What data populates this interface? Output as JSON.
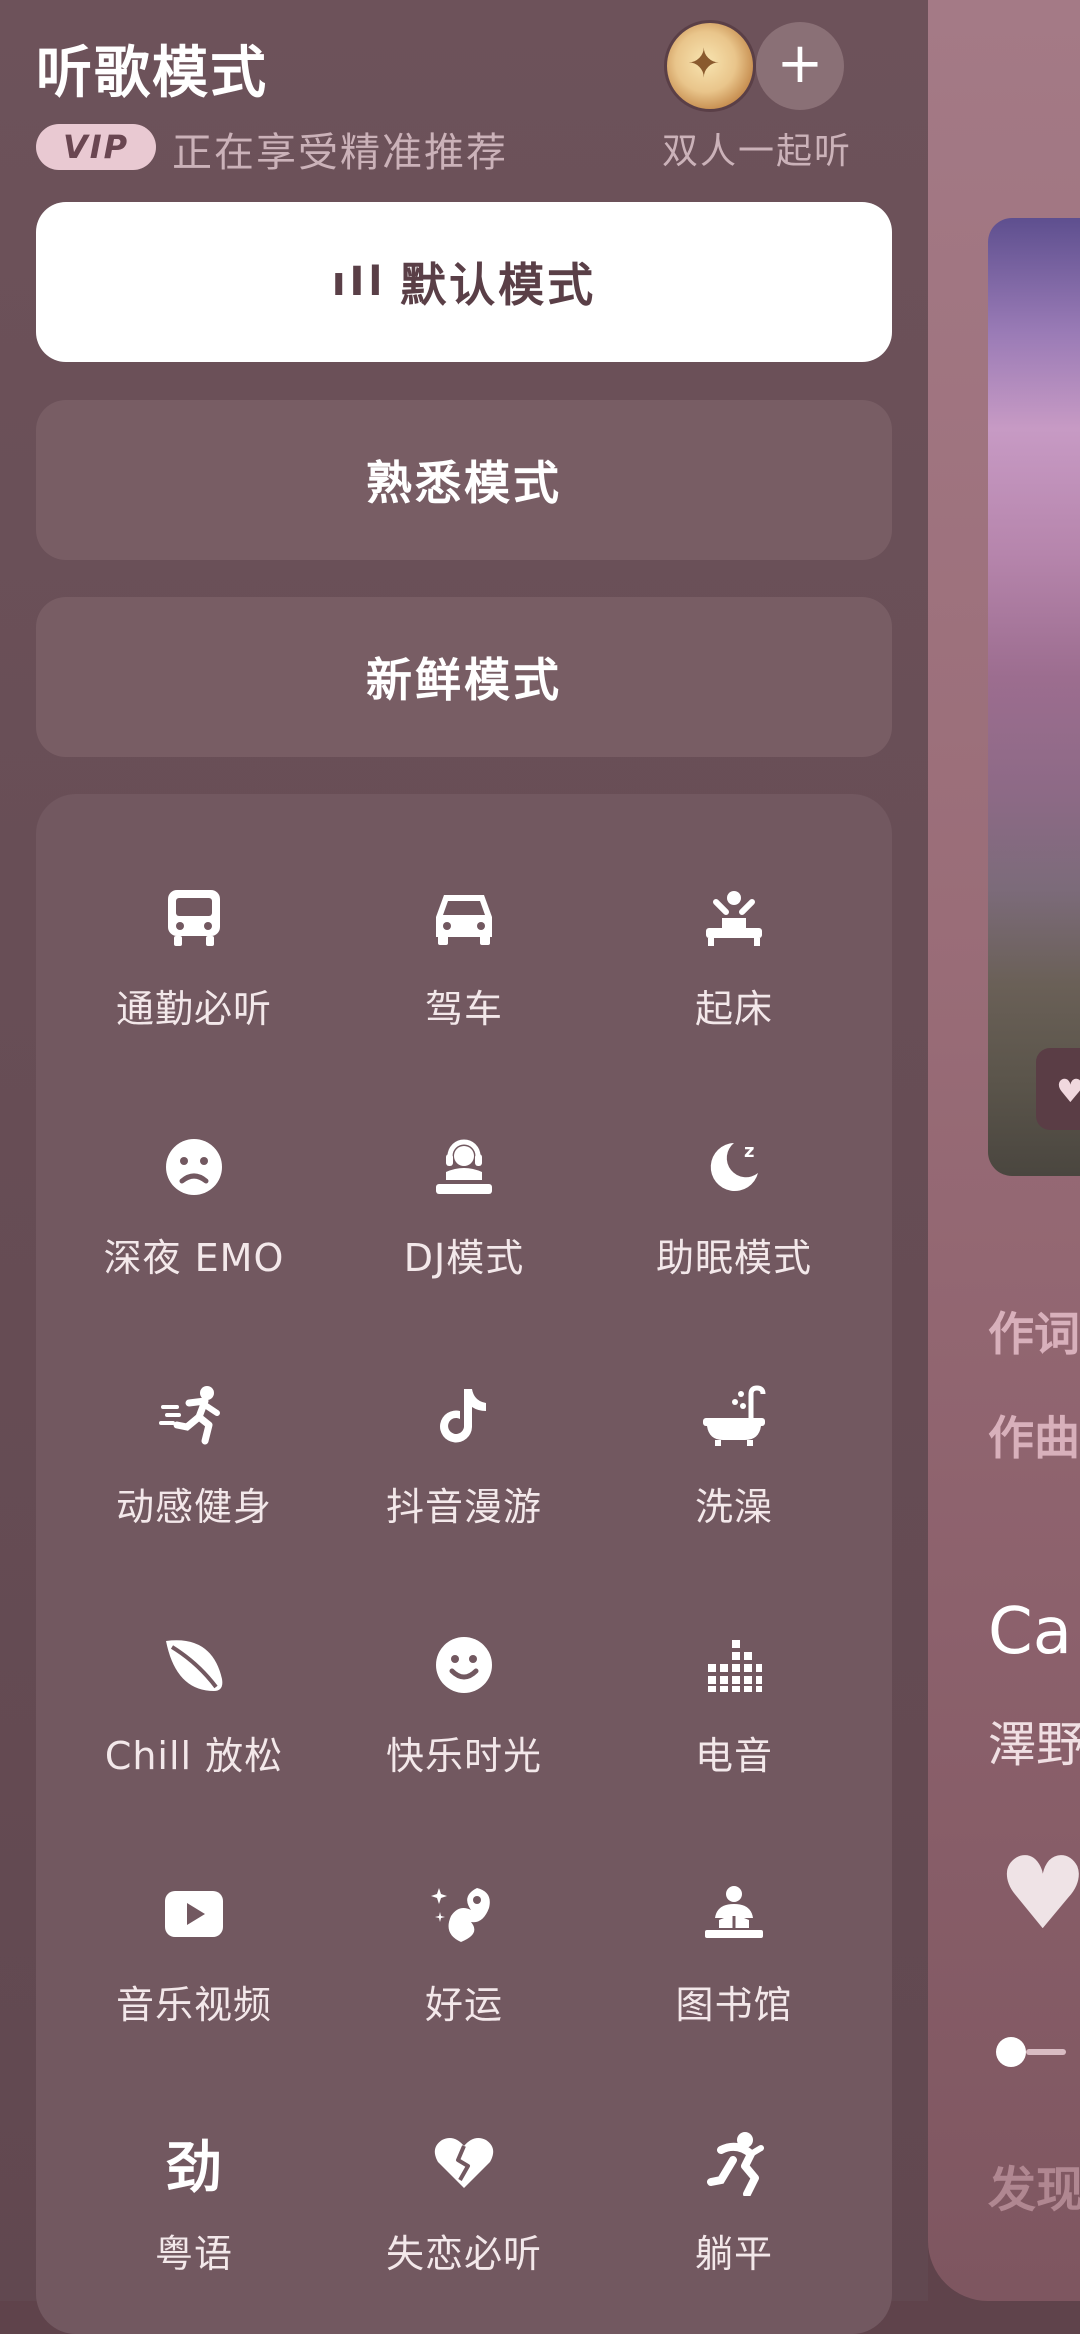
{
  "header": {
    "title": "听歌模式",
    "vip_badge": "VIP",
    "vip_text": "正在享受精准推荐",
    "plus_label": "+",
    "duet_label": "双人一起听"
  },
  "modes": {
    "default_bars": "ıIl",
    "default": "默认模式",
    "familiar": "熟悉模式",
    "fresh": "新鲜模式"
  },
  "scenes": [
    {
      "label": "通勤必听",
      "icon": "bus-icon"
    },
    {
      "label": "驾车",
      "icon": "car-icon"
    },
    {
      "label": "起床",
      "icon": "wake-up-icon"
    },
    {
      "label": "深夜 EMO",
      "icon": "sad-face-icon"
    },
    {
      "label": "DJ模式",
      "icon": "dj-icon"
    },
    {
      "label": "助眠模式",
      "icon": "moon-sleep-icon"
    },
    {
      "label": "动感健身",
      "icon": "running-icon"
    },
    {
      "label": "抖音漫游",
      "icon": "tiktok-icon"
    },
    {
      "label": "洗澡",
      "icon": "bathtub-icon"
    },
    {
      "label": "Chill 放松",
      "icon": "leaf-icon"
    },
    {
      "label": "快乐时光",
      "icon": "smile-icon"
    },
    {
      "label": "电音",
      "icon": "equalizer-icon"
    },
    {
      "label": "音乐视频",
      "icon": "video-play-icon"
    },
    {
      "label": "好运",
      "icon": "lucky-icon"
    },
    {
      "label": "图书馆",
      "icon": "library-icon"
    },
    {
      "label": "粤语",
      "icon": "cantonese-icon"
    },
    {
      "label": "失恋必听",
      "icon": "broken-heart-icon"
    },
    {
      "label": "躺平",
      "icon": "lie-flat-icon"
    }
  ],
  "cantonese_glyph": "劲",
  "player": {
    "lyricist": "作词",
    "composer": "作曲",
    "song_title": "Ca",
    "artist": "澤野",
    "discover": "发现",
    "heart_glyph": "♥",
    "progress_fraction": 0.0
  },
  "colors": {
    "panel_bg": "#6d525a",
    "card_bg": "#785d64",
    "accent": "#e9c9d2",
    "active_button": "#ffffff"
  }
}
